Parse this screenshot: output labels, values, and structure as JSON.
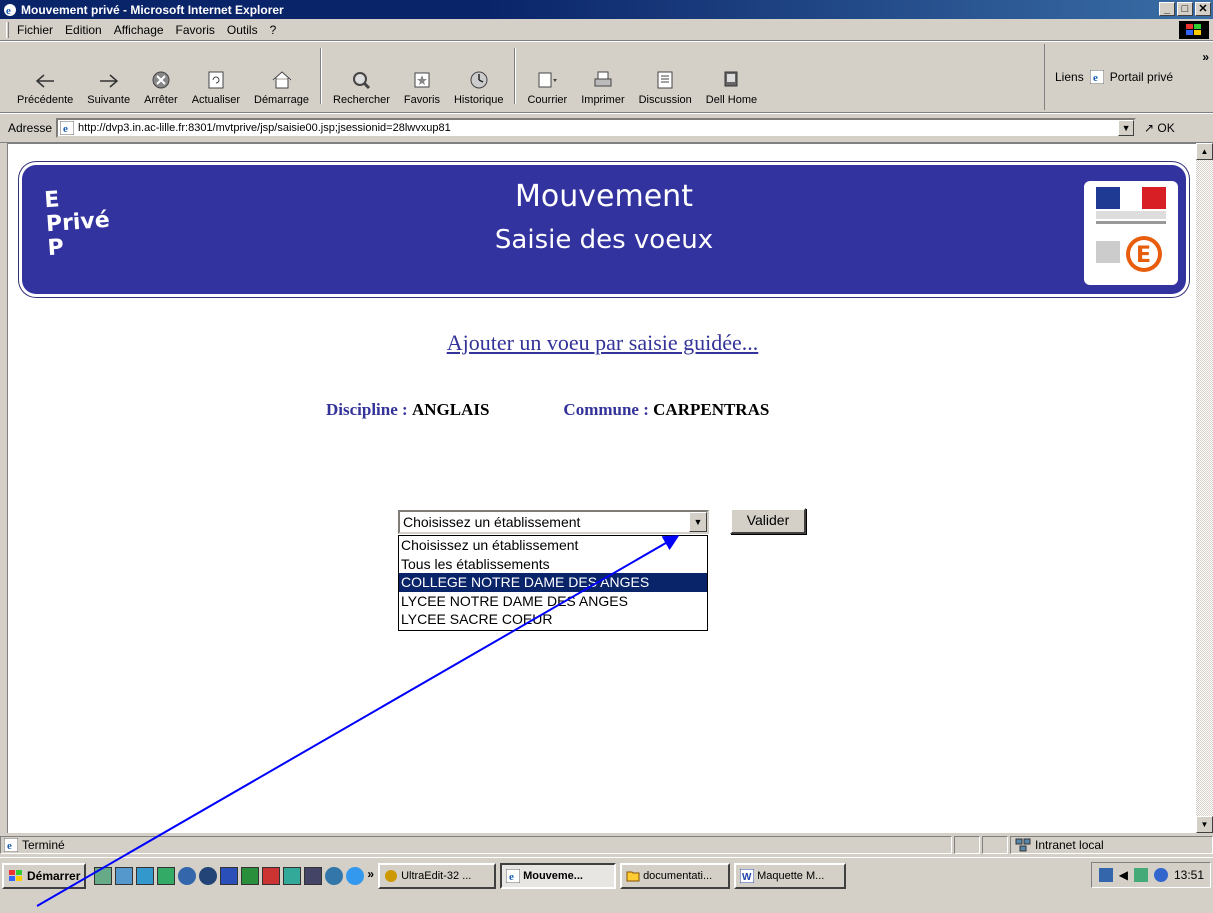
{
  "window": {
    "title": "Mouvement privé - Microsoft Internet Explorer",
    "controls": [
      "_",
      "□",
      "✕"
    ]
  },
  "menu": [
    "Fichier",
    "Edition",
    "Affichage",
    "Favoris",
    "Outils",
    "?"
  ],
  "toolbar": {
    "buttons": [
      "Précédente",
      "Suivante",
      "Arrêter",
      "Actualiser",
      "Démarrage",
      "Rechercher",
      "Favoris",
      "Historique",
      "Courrier",
      "Imprimer",
      "Discussion",
      "Dell Home"
    ],
    "links_label": "Liens",
    "portal_label": "Portail privé",
    "more": "»"
  },
  "address": {
    "label": "Adresse",
    "url": "http://dvp3.in.ac-lille.fr:8301/mvtprive/jsp/saisie00.jsp;jsessionid=28lwvxup81",
    "go": "OK"
  },
  "banner": {
    "logo_lines": [
      "E",
      "Privé",
      "P"
    ],
    "title": "Mouvement",
    "subtitle": "Saisie des voeux"
  },
  "page": {
    "heading": "Ajouter un voeu par saisie guidée...",
    "discipline_label": "Discipline :",
    "discipline_value": "ANGLAIS",
    "commune_label": "Commune :",
    "commune_value": "CARPENTRAS",
    "select_value": "Choisissez un établissement",
    "options": [
      "Choisissez un établissement",
      "Tous les établissements",
      "COLLEGE NOTRE DAME DES ANGES",
      "LYCEE NOTRE DAME DES ANGES",
      "LYCEE SACRE COEUR"
    ],
    "selected_option": "COLLEGE NOTRE DAME DES ANGES",
    "submit_label": "Valider"
  },
  "status": {
    "text": "Terminé",
    "zone": "Intranet local"
  },
  "taskbar": {
    "start_label": "Démarrer",
    "more": "»",
    "tasks": [
      "UltraEdit-32 ...",
      "Mouveme...",
      "documentati...",
      "Maquette M..."
    ],
    "active_task": "Mouveme...",
    "clock": "13:51"
  },
  "colors": {
    "banner": "#3333a0",
    "link": "#333399",
    "selection": "#0a246a",
    "annotation_arrow": "#0000ff"
  }
}
